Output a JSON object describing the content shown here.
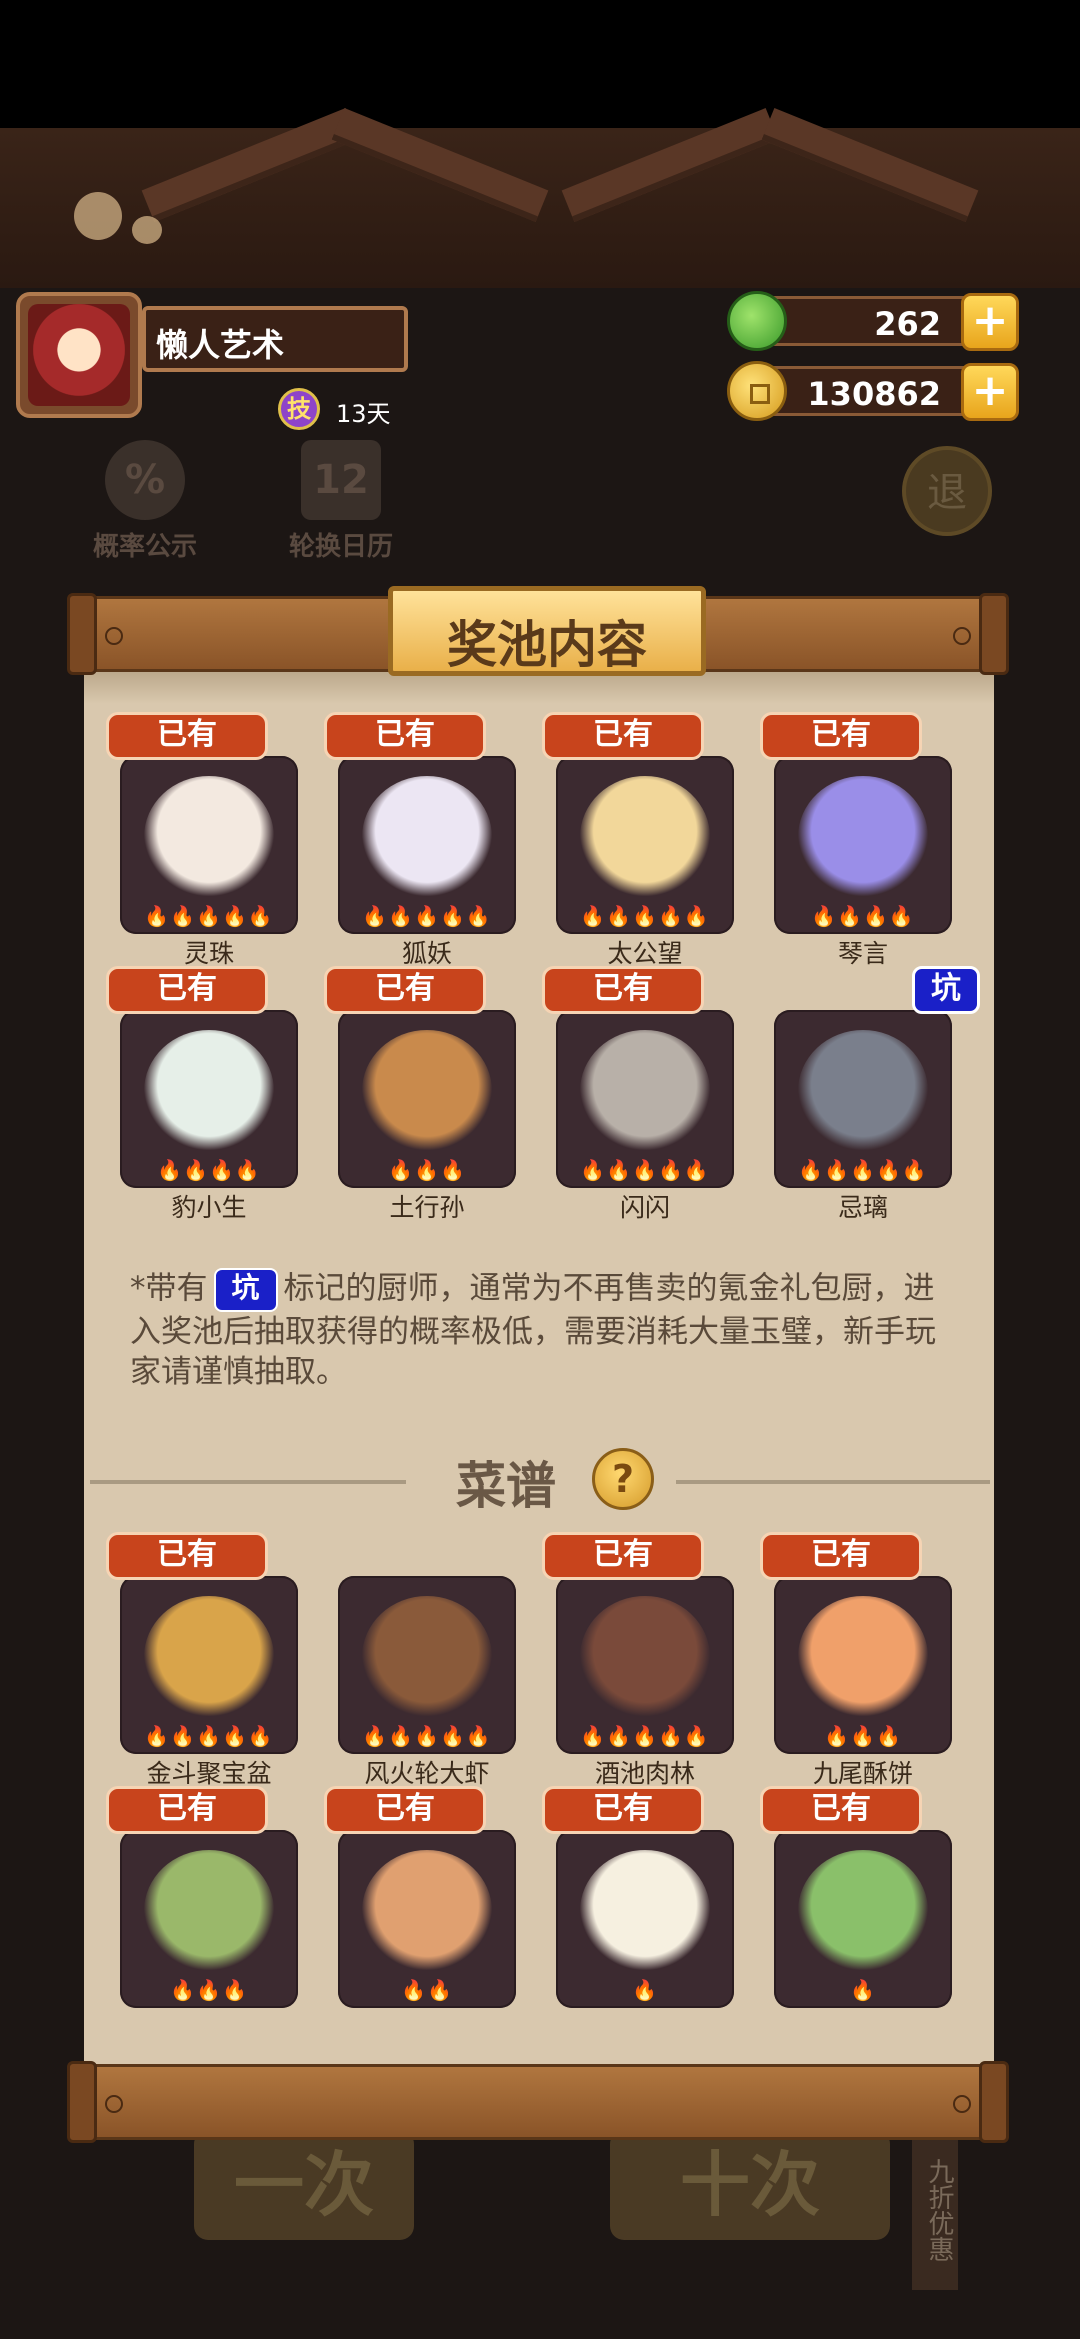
{
  "player": {
    "name": "懒人艺术",
    "skill_badge": "技",
    "skill_days": "13天"
  },
  "resources": {
    "jade": "262",
    "coins": "130862",
    "plus": "+"
  },
  "background": {
    "probability_label": "概率公示",
    "probability_icon": "%",
    "calendar_label": "轮换日历",
    "calendar_icon": "12",
    "back_label": "退",
    "single_draw": "一次",
    "ten_draw": "十次",
    "discount": "九折优惠"
  },
  "modal": {
    "title": "奖池内容",
    "chefs": [
      {
        "name": "灵珠",
        "tag": "已有",
        "flames": "🔥🔥🔥🔥🔥",
        "color": "#f3e9e0"
      },
      {
        "name": "狐妖",
        "tag": "已有",
        "flames": "🔥🔥🔥🔥🔥",
        "color": "#ece6f3"
      },
      {
        "name": "太公望",
        "tag": "已有",
        "flames": "🔥🔥🔥🔥🔥",
        "color": "#f2d79a"
      },
      {
        "name": "琴言",
        "tag": "已有",
        "flames": "🔥🔥🔥🔥",
        "color": "#9a8ee8"
      },
      {
        "name": "豹小生",
        "tag": "已有",
        "flames": "🔥🔥🔥🔥",
        "color": "#e6efe8"
      },
      {
        "name": "土行孙",
        "tag": "已有",
        "flames": "🔥🔥🔥",
        "color": "#c98a4c"
      },
      {
        "name": "闪闪",
        "tag": "已有",
        "flames": "🔥🔥🔥🔥🔥",
        "color": "#b8b0a8"
      },
      {
        "name": "忌璃",
        "tag": "坑",
        "flames": "🔥🔥🔥🔥🔥",
        "color": "#7a7f8c"
      }
    ],
    "note_before": "*带有",
    "note_pit": "坑",
    "note_after": "标记的厨师，通常为不再售卖的氪金礼包厨，进入奖池后抽取获得的概率极低，需要消耗大量玉璧，新手玩家请谨慎抽取。",
    "recipes_title": "菜谱",
    "help": "?",
    "recipes": [
      {
        "name": "金斗聚宝盆",
        "tag": "已有",
        "flames": "🔥🔥🔥🔥🔥",
        "color": "#d9a44a"
      },
      {
        "name": "风火轮大虾",
        "tag": "",
        "flames": "🔥🔥🔥🔥🔥",
        "color": "#8a5a3a"
      },
      {
        "name": "酒池肉林",
        "tag": "已有",
        "flames": "🔥🔥🔥🔥🔥",
        "color": "#7a4a3a"
      },
      {
        "name": "九尾酥饼",
        "tag": "已有",
        "flames": "🔥🔥🔥",
        "color": "#f0a06a"
      },
      {
        "name": "",
        "tag": "已有",
        "flames": "🔥🔥🔥",
        "color": "#9ab86a"
      },
      {
        "name": "",
        "tag": "已有",
        "flames": "🔥🔥",
        "color": "#e0a070"
      },
      {
        "name": "",
        "tag": "已有",
        "flames": "🔥",
        "color": "#f6f0e0"
      },
      {
        "name": "",
        "tag": "已有",
        "flames": "🔥",
        "color": "#8ac06a"
      }
    ]
  }
}
